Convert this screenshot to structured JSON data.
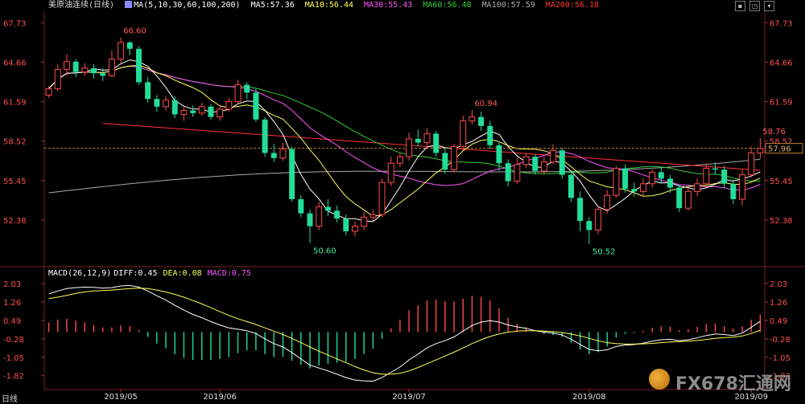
{
  "chart_title": {
    "instrument": "美原油连续",
    "period": "(日线)",
    "ma_label": "MA(5,10,30,60,100,200)",
    "ma5": "MA5:57.36",
    "ma10": "MA10:56.44",
    "ma30": "MA30:55.43",
    "ma60": "MA60:56.48",
    "ma100": "MA100:57.59",
    "ma200": "MA200:56.18"
  },
  "macd_title": {
    "label": "MACD(26,12,9)",
    "diff": "DIFF:0.45",
    "dea": "DEA:0.08",
    "macd": "MACD:0.75"
  },
  "bottom_label": "日线",
  "icons": [
    "maximize-icon",
    "restore-icon",
    "minimize-icon",
    "formula-icon"
  ],
  "colors": {
    "background": "#000000",
    "up": "#ff4a4a",
    "down": "#22dd99",
    "ma5": "#ffffff",
    "ma10": "#ffff55",
    "ma30": "#ff55ff",
    "ma60": "#33cc33",
    "ma100": "#aaaaaa",
    "ma200": "#ff3333",
    "current_price_line": "#c07f2a",
    "axis_text": "#ff4d4d"
  },
  "watermark": "FX678汇通网",
  "chart_data": [
    {
      "type": "candlestick",
      "y_ticks": [
        "67.73",
        "64.66",
        "61.59",
        "58.52",
        "55.45",
        "52.38"
      ],
      "ylim": [
        49.5,
        68.5
      ],
      "x_ticks": [
        "2019/05",
        "2019/06",
        "2019/07",
        "2019/08",
        "2019/09"
      ],
      "current_price": 57.96,
      "current_price_label": "57.96",
      "annotations": [
        {
          "text": "66.60",
          "x_index": 8,
          "value": 66.6
        },
        {
          "text": "50.60",
          "x_index": 29,
          "value": 50.6
        },
        {
          "text": "60.94",
          "x_index": 47,
          "value": 60.94
        },
        {
          "text": "50.52",
          "x_index": 60,
          "value": 50.52
        },
        {
          "text": "58.76",
          "x_index": 79,
          "value": 58.76
        }
      ],
      "candles": [
        [
          62.1,
          62.6,
          62.8,
          61.9
        ],
        [
          62.6,
          64.1,
          64.5,
          62.4
        ],
        [
          64.1,
          64.7,
          65.3,
          63.6
        ],
        [
          64.7,
          63.9,
          64.9,
          63.5
        ],
        [
          63.9,
          64.2,
          64.6,
          63.6
        ],
        [
          64.2,
          63.8,
          64.5,
          63.4
        ],
        [
          63.8,
          63.6,
          64.2,
          63.2
        ],
        [
          63.6,
          64.9,
          65.6,
          63.5
        ],
        [
          64.9,
          66.2,
          66.6,
          64.6
        ],
        [
          66.2,
          65.7,
          66.3,
          65.2
        ],
        [
          65.7,
          63.1,
          65.9,
          62.9
        ],
        [
          63.1,
          61.8,
          63.5,
          61.5
        ],
        [
          61.8,
          61.2,
          62.1,
          60.8
        ],
        [
          61.2,
          61.7,
          62.0,
          60.9
        ],
        [
          61.7,
          60.6,
          62.0,
          60.3
        ],
        [
          60.6,
          60.9,
          61.2,
          60.1
        ],
        [
          60.9,
          60.7,
          61.3,
          60.4
        ],
        [
          60.7,
          61.2,
          61.5,
          60.5
        ],
        [
          61.2,
          60.4,
          61.4,
          60.2
        ],
        [
          60.4,
          61.0,
          61.3,
          60.1
        ],
        [
          61.0,
          61.6,
          61.9,
          60.8
        ],
        [
          61.6,
          62.9,
          63.3,
          61.4
        ],
        [
          62.9,
          62.3,
          63.1,
          61.8
        ],
        [
          62.3,
          60.2,
          62.6,
          60.0
        ],
        [
          60.2,
          57.6,
          60.4,
          57.3
        ],
        [
          57.6,
          57.2,
          58.3,
          56.9
        ],
        [
          57.2,
          57.9,
          58.4,
          57.0
        ],
        [
          57.9,
          54.0,
          58.1,
          53.8
        ],
        [
          54.0,
          52.9,
          54.3,
          52.6
        ],
        [
          52.9,
          51.9,
          53.2,
          50.6
        ],
        [
          51.9,
          53.4,
          53.8,
          51.6
        ],
        [
          53.4,
          53.1,
          54.0,
          52.7
        ],
        [
          53.1,
          52.5,
          53.5,
          52.2
        ],
        [
          52.5,
          51.5,
          52.8,
          51.2
        ],
        [
          51.5,
          51.9,
          52.3,
          51.1
        ],
        [
          51.9,
          52.6,
          53.0,
          51.6
        ],
        [
          52.6,
          52.8,
          53.2,
          52.3
        ],
        [
          52.8,
          55.3,
          55.6,
          52.6
        ],
        [
          55.3,
          56.8,
          57.3,
          55.0
        ],
        [
          56.8,
          57.3,
          57.6,
          56.5
        ],
        [
          57.3,
          58.7,
          59.2,
          57.0
        ],
        [
          58.7,
          58.4,
          59.4,
          58.1
        ],
        [
          58.4,
          59.1,
          59.5,
          57.9
        ],
        [
          59.1,
          57.6,
          59.3,
          57.3
        ],
        [
          57.6,
          56.3,
          58.0,
          56.0
        ],
        [
          56.3,
          58.1,
          58.3,
          56.1
        ],
        [
          58.1,
          60.1,
          60.5,
          57.8
        ],
        [
          60.1,
          60.4,
          60.94,
          59.8
        ],
        [
          60.4,
          59.7,
          60.8,
          59.3
        ],
        [
          59.7,
          58.2,
          60.1,
          57.9
        ],
        [
          58.2,
          56.8,
          58.5,
          56.2
        ],
        [
          56.8,
          55.4,
          57.1,
          55.0
        ],
        [
          55.4,
          56.7,
          57.2,
          55.2
        ],
        [
          56.7,
          57.3,
          57.6,
          56.4
        ],
        [
          57.3,
          56.2,
          57.5,
          55.9
        ],
        [
          56.2,
          56.9,
          57.3,
          55.9
        ],
        [
          56.9,
          57.8,
          58.3,
          56.7
        ],
        [
          57.8,
          55.9,
          58.0,
          55.6
        ],
        [
          55.9,
          54.1,
          56.2,
          53.8
        ],
        [
          54.1,
          52.3,
          54.6,
          51.5
        ],
        [
          52.3,
          51.6,
          52.6,
          50.52
        ],
        [
          51.6,
          53.2,
          53.5,
          51.3
        ],
        [
          53.2,
          54.3,
          54.7,
          52.9
        ],
        [
          54.3,
          56.4,
          56.6,
          54.1
        ],
        [
          56.4,
          54.8,
          56.7,
          54.5
        ],
        [
          54.8,
          54.6,
          55.3,
          54.2
        ],
        [
          54.6,
          55.2,
          55.6,
          54.3
        ],
        [
          55.2,
          56.1,
          56.3,
          54.9
        ],
        [
          56.1,
          55.6,
          56.5,
          55.2
        ],
        [
          55.6,
          54.9,
          55.9,
          54.5
        ],
        [
          54.9,
          53.3,
          55.1,
          53.0
        ],
        [
          53.3,
          54.6,
          54.9,
          53.1
        ],
        [
          54.6,
          55.2,
          55.6,
          54.2
        ],
        [
          55.2,
          56.4,
          56.8,
          54.9
        ],
        [
          56.4,
          56.3,
          56.9,
          55.9
        ],
        [
          56.3,
          55.2,
          56.6,
          54.9
        ],
        [
          55.2,
          54.0,
          55.5,
          53.6
        ],
        [
          54.0,
          55.9,
          56.3,
          53.5
        ],
        [
          55.9,
          57.6,
          58.1,
          55.7
        ],
        [
          57.6,
          57.96,
          58.76,
          57.2
        ]
      ]
    },
    {
      "type": "macd",
      "y_ticks": [
        "2.03",
        "1.26",
        "0.49",
        "-0.28",
        "-1.05",
        "-1.82"
      ],
      "ylim": [
        -2.3,
        2.2
      ],
      "diff": [
        1.6,
        1.72,
        1.82,
        1.86,
        1.88,
        1.87,
        1.84,
        1.86,
        1.93,
        1.95,
        1.88,
        1.72,
        1.52,
        1.34,
        1.12,
        0.92,
        0.74,
        0.6,
        0.44,
        0.3,
        0.18,
        0.12,
        0.06,
        -0.06,
        -0.28,
        -0.48,
        -0.62,
        -0.86,
        -1.12,
        -1.38,
        -1.5,
        -1.62,
        -1.76,
        -1.9,
        -2.0,
        -2.04,
        -2.05,
        -1.9,
        -1.68,
        -1.46,
        -1.16,
        -0.92,
        -0.66,
        -0.48,
        -0.36,
        -0.2,
        0.04,
        0.28,
        0.42,
        0.48,
        0.42,
        0.3,
        0.22,
        0.16,
        0.06,
        0.0,
        -0.04,
        -0.12,
        -0.3,
        -0.52,
        -0.72,
        -0.78,
        -0.74,
        -0.6,
        -0.54,
        -0.52,
        -0.46,
        -0.38,
        -0.32,
        -0.3,
        -0.36,
        -0.32,
        -0.24,
        -0.14,
        -0.08,
        -0.1,
        -0.14,
        -0.04,
        0.2,
        0.45
      ],
      "dea": [
        1.4,
        1.46,
        1.54,
        1.62,
        1.68,
        1.72,
        1.74,
        1.76,
        1.79,
        1.82,
        1.84,
        1.82,
        1.76,
        1.68,
        1.58,
        1.46,
        1.32,
        1.18,
        1.02,
        0.86,
        0.7,
        0.56,
        0.44,
        0.32,
        0.18,
        0.04,
        -0.1,
        -0.26,
        -0.44,
        -0.62,
        -0.8,
        -0.96,
        -1.12,
        -1.28,
        -1.44,
        -1.58,
        -1.7,
        -1.76,
        -1.76,
        -1.72,
        -1.62,
        -1.48,
        -1.32,
        -1.16,
        -1.0,
        -0.84,
        -0.66,
        -0.48,
        -0.32,
        -0.18,
        -0.08,
        0.0,
        0.04,
        0.06,
        0.06,
        0.04,
        0.02,
        -0.02,
        -0.08,
        -0.16,
        -0.26,
        -0.36,
        -0.44,
        -0.48,
        -0.5,
        -0.5,
        -0.49,
        -0.47,
        -0.44,
        -0.41,
        -0.4,
        -0.38,
        -0.35,
        -0.31,
        -0.26,
        -0.23,
        -0.21,
        -0.16,
        -0.06,
        0.08
      ]
    }
  ]
}
